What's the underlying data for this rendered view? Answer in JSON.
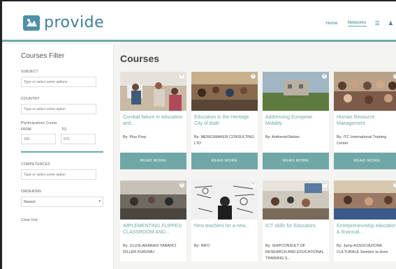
{
  "header": {
    "logo_text": "provide",
    "nav": {
      "home": "Home",
      "networks": "Networks",
      "menu_icon": "☰",
      "user_icon": "♟"
    }
  },
  "sidebar": {
    "title": "Courses Filter",
    "subject_label": "SUBJECT",
    "subject_placeholder": "Type or select some options",
    "country_label": "COUNTRY",
    "country_placeholder": "Type or select some option",
    "participation_label": "Participation Costs",
    "from_label": "FROM",
    "to_label": "TO",
    "from_value": "200",
    "to_value": "670",
    "competences_label": "COMPETENCES",
    "competences_placeholder": "Type or select some option",
    "ordering_label": "ORDERING",
    "ordering_value": "Newest",
    "clear_label": "Clear line"
  },
  "main": {
    "title": "Courses",
    "read_more": "READ MORE",
    "cards": [
      {
        "title": "Combat failure in education and...",
        "by": "By: Plus Porp"
      },
      {
        "title": "Education in the Heritage City of Bath",
        "by": "By: MERESMAKER CONSULTING LTD"
      },
      {
        "title": "Addressing European Mobility",
        "by": "By: Anthenis/Stokes"
      },
      {
        "title": "Human Resource Management",
        "by": "By: ITC International Training Center"
      },
      {
        "title": "IMPLEMENTING FLIPPED CLASSROOM AND...",
        "by": "By: ULUSLARARASI YABANCI DILLER KURUMU"
      },
      {
        "title": "New teachers for a new...",
        "by": "By: INFO"
      },
      {
        "title": "ICT skills for Educators",
        "by": "By: SHIPCONSULT OF RESEARCH AND EDUCATIONAL TRAINING S..."
      },
      {
        "title": "Entrepreneurship education & financial...",
        "by": "By: Jump ASSOCIAZIONE CULTURALE Sweden Ia donn"
      }
    ]
  },
  "colors": {
    "accent": "#6fa8a6",
    "brand": "#3f7e9a"
  }
}
